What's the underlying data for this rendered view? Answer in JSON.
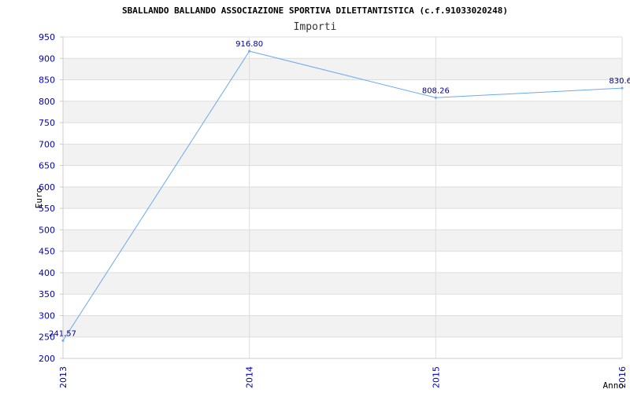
{
  "chart_data": {
    "type": "line",
    "title": "SBALLANDO BALLANDO ASSOCIAZIONE SPORTIVA DILETTANTISTICA (c.f.91033020248)",
    "subtitle": "Importi",
    "xlabel": "Anno",
    "ylabel": "Euro",
    "categories": [
      "2013",
      "2014",
      "2015",
      "2016"
    ],
    "series": [
      {
        "values": [
          241.57,
          916.8,
          808.26,
          830.6
        ]
      }
    ],
    "data_labels": [
      "241.57",
      "916.80",
      "808.26",
      "830.6"
    ],
    "ylim": [
      200,
      950
    ],
    "yticks": [
      "200",
      "250",
      "300",
      "350",
      "400",
      "450",
      "500",
      "550",
      "600",
      "650",
      "700",
      "750",
      "800",
      "850",
      "900",
      "950"
    ],
    "grid": true,
    "colors": {
      "line": "#6aaaf0",
      "band": "#f2f2f2",
      "tick_text": "#0000bb",
      "label_text": "#000088"
    }
  }
}
